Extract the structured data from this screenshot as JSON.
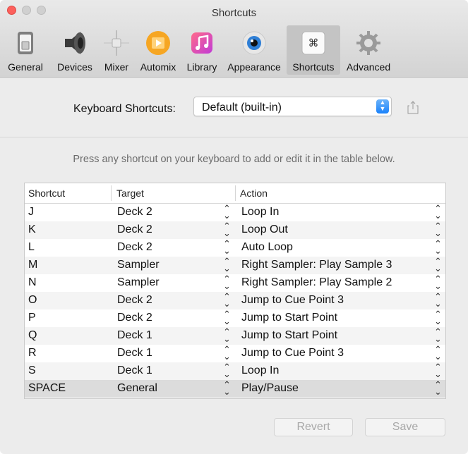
{
  "window": {
    "title": "Shortcuts"
  },
  "toolbar": {
    "items": [
      {
        "label": "General",
        "icon": "general-switch-icon"
      },
      {
        "label": "Devices",
        "icon": "speaker-icon"
      },
      {
        "label": "Mixer",
        "icon": "mixer-slider-icon"
      },
      {
        "label": "Automix",
        "icon": "automix-icon"
      },
      {
        "label": "Library",
        "icon": "music-note-icon"
      },
      {
        "label": "Appearance",
        "icon": "eye-icon"
      },
      {
        "label": "Shortcuts",
        "icon": "command-key-icon",
        "selected": true
      },
      {
        "label": "Advanced",
        "icon": "gear-icon"
      }
    ]
  },
  "keyboard_shortcuts": {
    "label": "Keyboard Shortcuts:",
    "selected": "Default (built-in)"
  },
  "hint": "Press any shortcut on your keyboard to add or edit it in the table below.",
  "table": {
    "columns": [
      "Shortcut",
      "Target",
      "Action"
    ],
    "rows": [
      {
        "shortcut": "J",
        "target": "Deck 2",
        "action": "Loop In"
      },
      {
        "shortcut": "K",
        "target": "Deck 2",
        "action": "Loop Out"
      },
      {
        "shortcut": "L",
        "target": "Deck 2",
        "action": "Auto Loop"
      },
      {
        "shortcut": "M",
        "target": "Sampler",
        "action": "Right Sampler: Play Sample 3"
      },
      {
        "shortcut": "N",
        "target": "Sampler",
        "action": "Right Sampler: Play Sample 2"
      },
      {
        "shortcut": "O",
        "target": "Deck 2",
        "action": "Jump to Cue Point 3"
      },
      {
        "shortcut": "P",
        "target": "Deck 2",
        "action": "Jump to Start Point"
      },
      {
        "shortcut": "Q",
        "target": "Deck 1",
        "action": "Jump to Start Point"
      },
      {
        "shortcut": "R",
        "target": "Deck 1",
        "action": "Jump to Cue Point 3"
      },
      {
        "shortcut": "S",
        "target": "Deck 1",
        "action": "Loop In"
      },
      {
        "shortcut": "SPACE",
        "target": "General",
        "action": "Play/Pause",
        "selected": true
      }
    ]
  },
  "buttons": {
    "revert": "Revert",
    "save": "Save"
  },
  "colors": {
    "accent": "#1a82fb",
    "close": "#fc605c",
    "selection": "#dcdcdc"
  }
}
